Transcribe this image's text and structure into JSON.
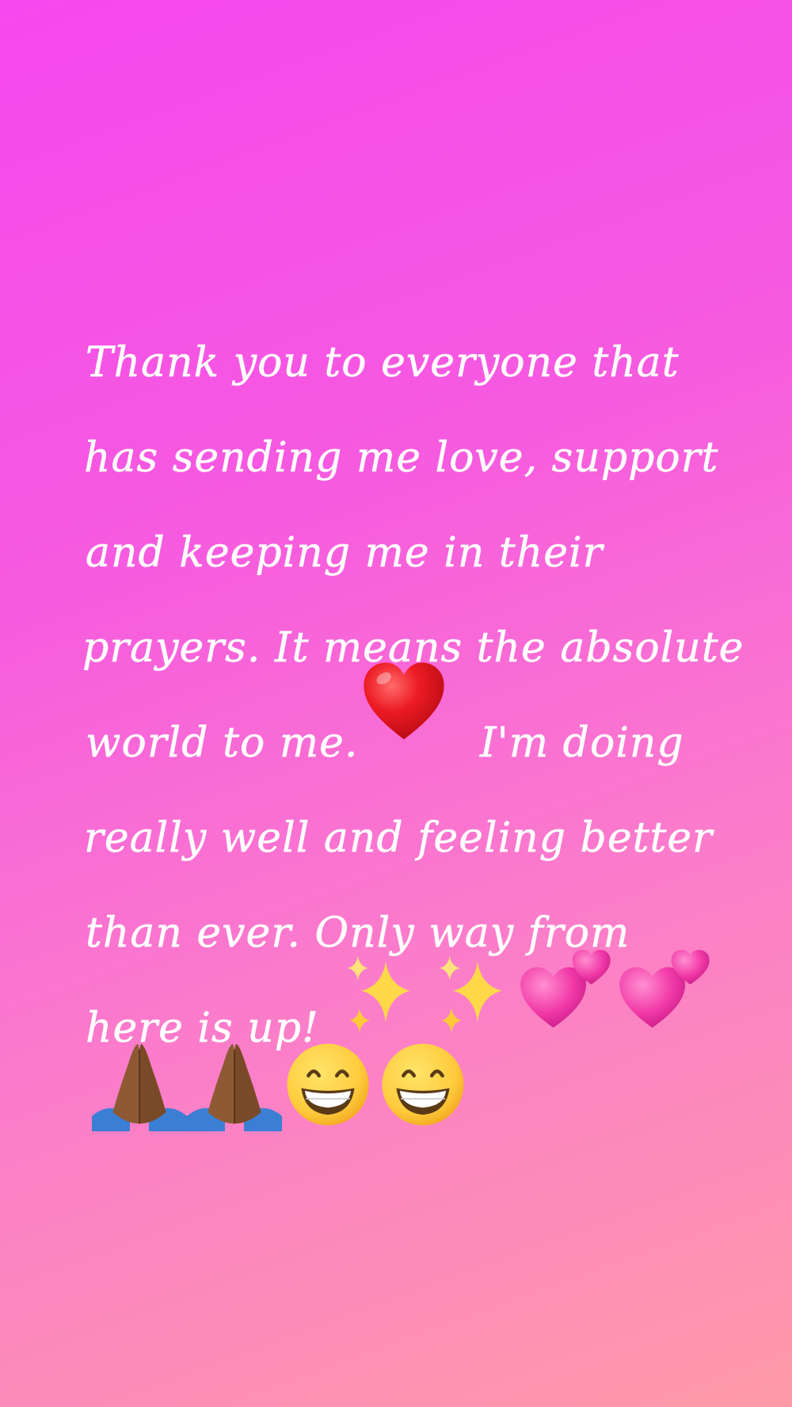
{
  "post": {
    "lines": [
      "Thank you to everyone that",
      "has sending me love, support",
      "and keeping me in their",
      "prayers. It means the absolute",
      "world to me.",
      "I'm doing",
      "really well and feeling better",
      "than ever. Only way from",
      "here is up!"
    ]
  },
  "emojis": [
    {
      "name": "red-heart-icon",
      "char": "❤"
    },
    {
      "name": "sparkles-icon",
      "char": "✨"
    },
    {
      "name": "sparkles-icon",
      "char": "✨"
    },
    {
      "name": "two-hearts-icon",
      "char": "💕"
    },
    {
      "name": "two-hearts-icon",
      "char": "💕"
    },
    {
      "name": "folded-hands-icon",
      "char": "🙏🏾"
    },
    {
      "name": "folded-hands-icon",
      "char": "🙏🏾"
    },
    {
      "name": "grinning-face-icon",
      "char": "😁"
    },
    {
      "name": "grinning-face-icon",
      "char": "😁"
    }
  ],
  "colors": {
    "gradient_start": "#f648ee",
    "gradient_end": "#fe9aa8",
    "text": "#ffffff",
    "heart_red": "#e0141e",
    "heart_pink": "#f23aa8",
    "sparkle_yellow": "#ffd84a",
    "skin_brown": "#8d5a33",
    "sleeve_blue": "#3b7fd4",
    "face_yellow": "#ffcb3d"
  }
}
